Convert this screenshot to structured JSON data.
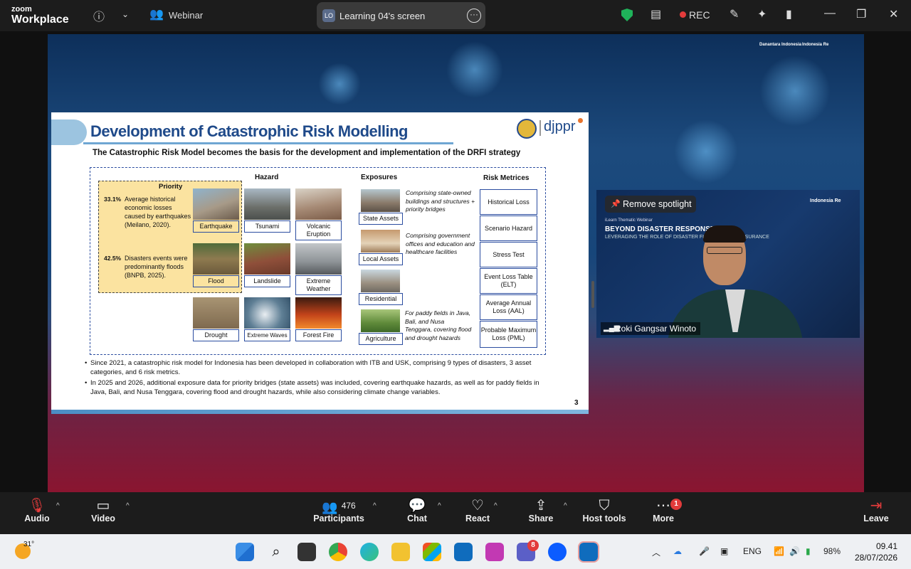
{
  "topbar": {
    "logo_line1": "zoom",
    "logo_line2": "Workplace",
    "meeting_type": "Webinar",
    "screen_share_initials": "LO",
    "screen_share_title": "Learning 04's screen",
    "rec_label": "REC"
  },
  "slide": {
    "title": "Development of Catastrophic Risk Modelling",
    "logo_text": "djppr",
    "subtitle": "The Catastrophic Risk Model becomes the basis for the development and implementation of the DRFI strategy",
    "headers": {
      "hazard": "Hazard",
      "exposures": "Exposures",
      "risk_metrics": "Risk Metrices",
      "priority": "Priority"
    },
    "priority": [
      {
        "stat": "33.1%",
        "text": "Average historical economic losses caused by earthquakes (Meilano, 2020)."
      },
      {
        "stat": "42.5%",
        "text": "Disasters events were predominantly floods (BNPB, 2025)."
      }
    ],
    "hazards": [
      "Earthquake",
      "Tsunami",
      "Volcanic Eruption",
      "Flood",
      "Landslide",
      "Extreme Weather",
      "Drought",
      "Extreme Waves",
      "Forest Fire"
    ],
    "exposures": [
      {
        "label": "State Assets",
        "desc": "Comprising state-owned buildings and structures + priority bridges"
      },
      {
        "label": "Local Assets",
        "desc": "Comprising government offices and education and healthcare facilities"
      },
      {
        "label": "Residential",
        "desc": ""
      },
      {
        "label": "Agriculture",
        "desc": "For paddy fields in Java, Bali, and Nusa Tenggara, covering flood and drought hazards"
      }
    ],
    "risk_metrics": [
      "Historical Loss",
      "Scenario Hazard",
      "Stress Test",
      "Event Loss Table (ELT)",
      "Average Annual Loss (AAL)",
      "Probable Maximum Loss (PML)"
    ],
    "bullets": [
      "Since 2021, a catastrophic risk model for Indonesia has been developed in collaboration with ITB and USK, comprising 9 types of disasters, 3 asset categories, and 6 risk metrics.",
      "In 2025 and 2026, additional exposure data for priority bridges (state assets) was included, covering earthquake hazards, as well as for paddy fields in Java, Bali, and Nusa Tenggara, covering flood and drought hazards, while also considering climate change variables."
    ],
    "page_number": "3"
  },
  "background_brands": {
    "brand1": "Danantara Indonesia",
    "brand2": "Indonesia Re"
  },
  "video": {
    "remove_spotlight": "Remove spotlight",
    "webinar_line1": "iLearn Thematic Webinar",
    "webinar_line2": "BEYOND DISASTER RESPONSE",
    "webinar_line3": "LEVERAGING THE ROLE OF DISASTER FINANCING AND INSURANCE",
    "brand": "Indonesia Re",
    "participant_name": "Roki Gangsar Winoto"
  },
  "toolbar": {
    "audio": "Audio",
    "video": "Video",
    "participants": "Participants",
    "participants_count": "476",
    "chat": "Chat",
    "react": "React",
    "share": "Share",
    "host_tools": "Host tools",
    "more": "More",
    "more_badge": "1",
    "leave": "Leave"
  },
  "taskbar": {
    "temperature": "31°",
    "teams_badge": "8",
    "language": "ENG",
    "battery": "98%",
    "time": "09.41",
    "date": "28/07/2026"
  },
  "colors": {
    "accent_blue": "#1f4a8a",
    "priority_fill": "#fbe3a0",
    "rec_red": "#e23b3b",
    "shield_green": "#1fb35a"
  }
}
